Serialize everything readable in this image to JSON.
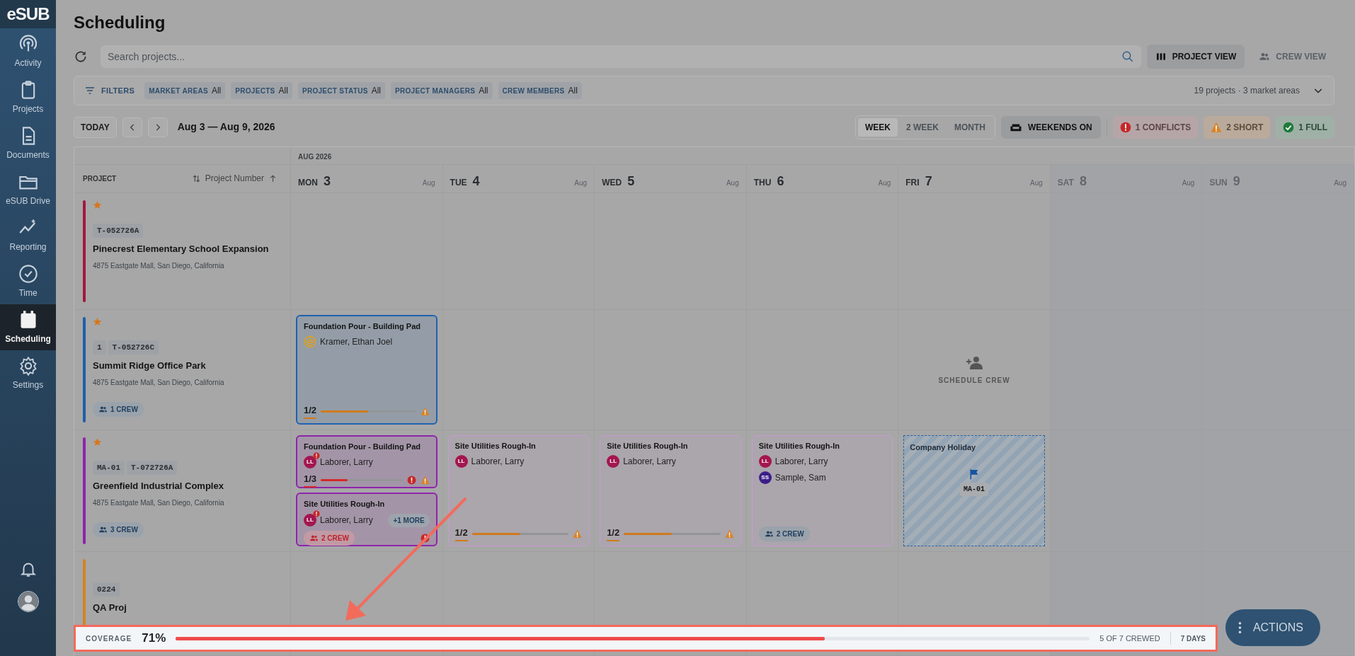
{
  "app": {
    "logo": "eSUB"
  },
  "sidebar": {
    "items": [
      {
        "label": "Activity",
        "selected": false
      },
      {
        "label": "Projects",
        "selected": false
      },
      {
        "label": "Documents",
        "selected": false
      },
      {
        "label": "eSUB Drive",
        "selected": false
      },
      {
        "label": "Reporting",
        "selected": false
      },
      {
        "label": "Time",
        "selected": false
      },
      {
        "label": "Scheduling",
        "selected": true
      },
      {
        "label": "Settings",
        "selected": false
      }
    ]
  },
  "page": {
    "title": "Scheduling"
  },
  "search": {
    "placeholder": "Search projects..."
  },
  "views": [
    {
      "label": "PROJECT VIEW",
      "selected": true
    },
    {
      "label": "CREW VIEW",
      "selected": false
    }
  ],
  "filters": {
    "label": "FILTERS",
    "chips": [
      {
        "label": "MARKET AREAS",
        "value": "All"
      },
      {
        "label": "PROJECTS",
        "value": "All"
      },
      {
        "label": "PROJECT STATUS",
        "value": "All"
      },
      {
        "label": "PROJECT MANAGERS",
        "value": "All"
      },
      {
        "label": "CREW MEMBERS",
        "value": "All"
      }
    ],
    "summary": "19 projects · 3 market areas"
  },
  "toolbar": {
    "today": "TODAY",
    "range": "Aug 3 — Aug 9, 2026",
    "spans": [
      {
        "label": "WEEK",
        "selected": true
      },
      {
        "label": "2 WEEK",
        "selected": false
      },
      {
        "label": "MONTH",
        "selected": false
      }
    ],
    "weekends": "WEEKENDS ON",
    "stats": [
      {
        "kind": "conflict",
        "count": "1",
        "label": "CONFLICTS"
      },
      {
        "kind": "short",
        "count": "2",
        "label": "SHORT"
      },
      {
        "kind": "full",
        "count": "1",
        "label": "FULL"
      }
    ]
  },
  "grid": {
    "month": "AUG 2026",
    "project_header": "PROJECT",
    "sort_label": "Project Number",
    "days": [
      {
        "dow": "MON",
        "day": "3",
        "month": "Aug",
        "weekend": false
      },
      {
        "dow": "TUE",
        "day": "4",
        "month": "Aug",
        "weekend": false
      },
      {
        "dow": "WED",
        "day": "5",
        "month": "Aug",
        "weekend": false
      },
      {
        "dow": "THU",
        "day": "6",
        "month": "Aug",
        "weekend": false
      },
      {
        "dow": "FRI",
        "day": "7",
        "month": "Aug",
        "weekend": false
      },
      {
        "dow": "SAT",
        "day": "8",
        "month": "Aug",
        "weekend": true
      },
      {
        "dow": "SUN",
        "day": "9",
        "month": "Aug",
        "weekend": true
      }
    ],
    "rows": [
      {
        "starred": true,
        "color": "#a3173f",
        "codes": [
          "T-052726A"
        ],
        "name": "Pinecrest Elementary School Expansion",
        "address": "4875 Eastgate Mall, San Diego, California",
        "cells": [
          {
            "kind": "empty"
          },
          {
            "kind": "empty"
          },
          {
            "kind": "empty"
          },
          {
            "kind": "empty"
          },
          {
            "kind": "empty"
          },
          {
            "kind": "empty"
          },
          {
            "kind": "empty"
          }
        ]
      },
      {
        "starred": true,
        "color": "#1e5fa8",
        "codes": [
          "1",
          "T-052726C"
        ],
        "name": "Summit Ridge Office Park",
        "address": "4875 Eastgate Mall, San Diego, California",
        "crew": "1 CREW",
        "cells": [
          {
            "kind": "cards",
            "cards": [
              {
                "title": "Foundation Pour - Building Pad",
                "color": "#1f62b0",
                "highlighted": true,
                "members": [
                  {
                    "kind": "logo",
                    "name": "Kramer, Ethan Joel"
                  }
                ],
                "progress": {
                  "text": "1/2",
                  "level": 0.5,
                  "color": "#d07a1c"
                },
                "short": true
              }
            ]
          },
          {
            "kind": "empty"
          },
          {
            "kind": "empty"
          },
          {
            "kind": "empty"
          },
          {
            "kind": "schedule",
            "label": "SCHEDULE CREW"
          },
          {
            "kind": "empty"
          },
          {
            "kind": "empty"
          }
        ]
      },
      {
        "starred": true,
        "color": "#8e24aa",
        "codes": [
          "MA-01",
          "T-072726A"
        ],
        "name": "Greenfield Industrial Complex",
        "address": "4875 Eastgate Mall, San Diego, California",
        "crew": "3 CREW",
        "cells": [
          {
            "kind": "cards",
            "cards": [
              {
                "title": "Foundation Pour - Building Pad",
                "color": "#8e24aa",
                "highlighted": true,
                "members": [
                  {
                    "kind": "initials",
                    "initials": "LL",
                    "name": "Laborer, Larry",
                    "color": "#a3164f",
                    "alert": true
                  }
                ],
                "progress": {
                  "text": "1/3",
                  "level": 0.33,
                  "color": "#d42a2a"
                },
                "conflict": true,
                "short": true
              },
              {
                "title": "Site Utilities Rough-In",
                "color": "#8e24aa",
                "highlighted": true,
                "members": [
                  {
                    "kind": "initials",
                    "initials": "LL",
                    "name": "Laborer, Larry",
                    "color": "#a3164f",
                    "alert": true
                  }
                ],
                "more": "+1 MORE",
                "crew": {
                  "label": "2 CREW",
                  "alert": true
                },
                "conflict": true
              }
            ]
          },
          {
            "kind": "cards",
            "cards": [
              {
                "title": "Site Utilities Rough-In",
                "color": "#c79bd2",
                "highlighted": false,
                "members": [
                  {
                    "kind": "initials",
                    "initials": "LL",
                    "name": "Laborer, Larry",
                    "color": "#a3164f",
                    "alert": false
                  }
                ],
                "progress": {
                  "text": "1/2",
                  "level": 0.5,
                  "color": "#d07a1c"
                },
                "short": true
              }
            ]
          },
          {
            "kind": "cards",
            "cards": [
              {
                "title": "Site Utilities Rough-In",
                "color": "#c79bd2",
                "highlighted": false,
                "members": [
                  {
                    "kind": "initials",
                    "initials": "LL",
                    "name": "Laborer, Larry",
                    "color": "#a3164f",
                    "alert": false
                  }
                ],
                "progress": {
                  "text": "1/2",
                  "level": 0.5,
                  "color": "#d07a1c"
                },
                "short": true
              }
            ]
          },
          {
            "kind": "cards",
            "cards": [
              {
                "title": "Site Utilities Rough-In",
                "color": "#c79bd2",
                "highlighted": false,
                "members": [
                  {
                    "kind": "initials",
                    "initials": "LL",
                    "name": "Laborer, Larry",
                    "color": "#a3164f",
                    "alert": false
                  },
                  {
                    "kind": "initials",
                    "initials": "SS",
                    "name": "Sample, Sam",
                    "color": "#3b1f8a",
                    "alert": false
                  }
                ],
                "crew": {
                  "label": "2 CREW",
                  "alert": false
                }
              }
            ]
          },
          {
            "kind": "holiday",
            "title": "Company Holiday",
            "code": "MA-01"
          },
          {
            "kind": "empty"
          },
          {
            "kind": "empty"
          }
        ]
      },
      {
        "starred": false,
        "color": "#d4841f",
        "codes": [
          "0224"
        ],
        "name": "QA Proj",
        "cells": [
          {
            "kind": "empty"
          },
          {
            "kind": "empty"
          },
          {
            "kind": "empty"
          },
          {
            "kind": "empty"
          },
          {
            "kind": "empty"
          },
          {
            "kind": "empty"
          },
          {
            "kind": "empty"
          }
        ]
      }
    ]
  },
  "coverage": {
    "label": "COVERAGE",
    "percent": "71%",
    "level": 0.71,
    "crewed": "5 OF 7 CREWED",
    "days": "7 DAYS"
  },
  "actions": {
    "label": "ACTIONS"
  }
}
